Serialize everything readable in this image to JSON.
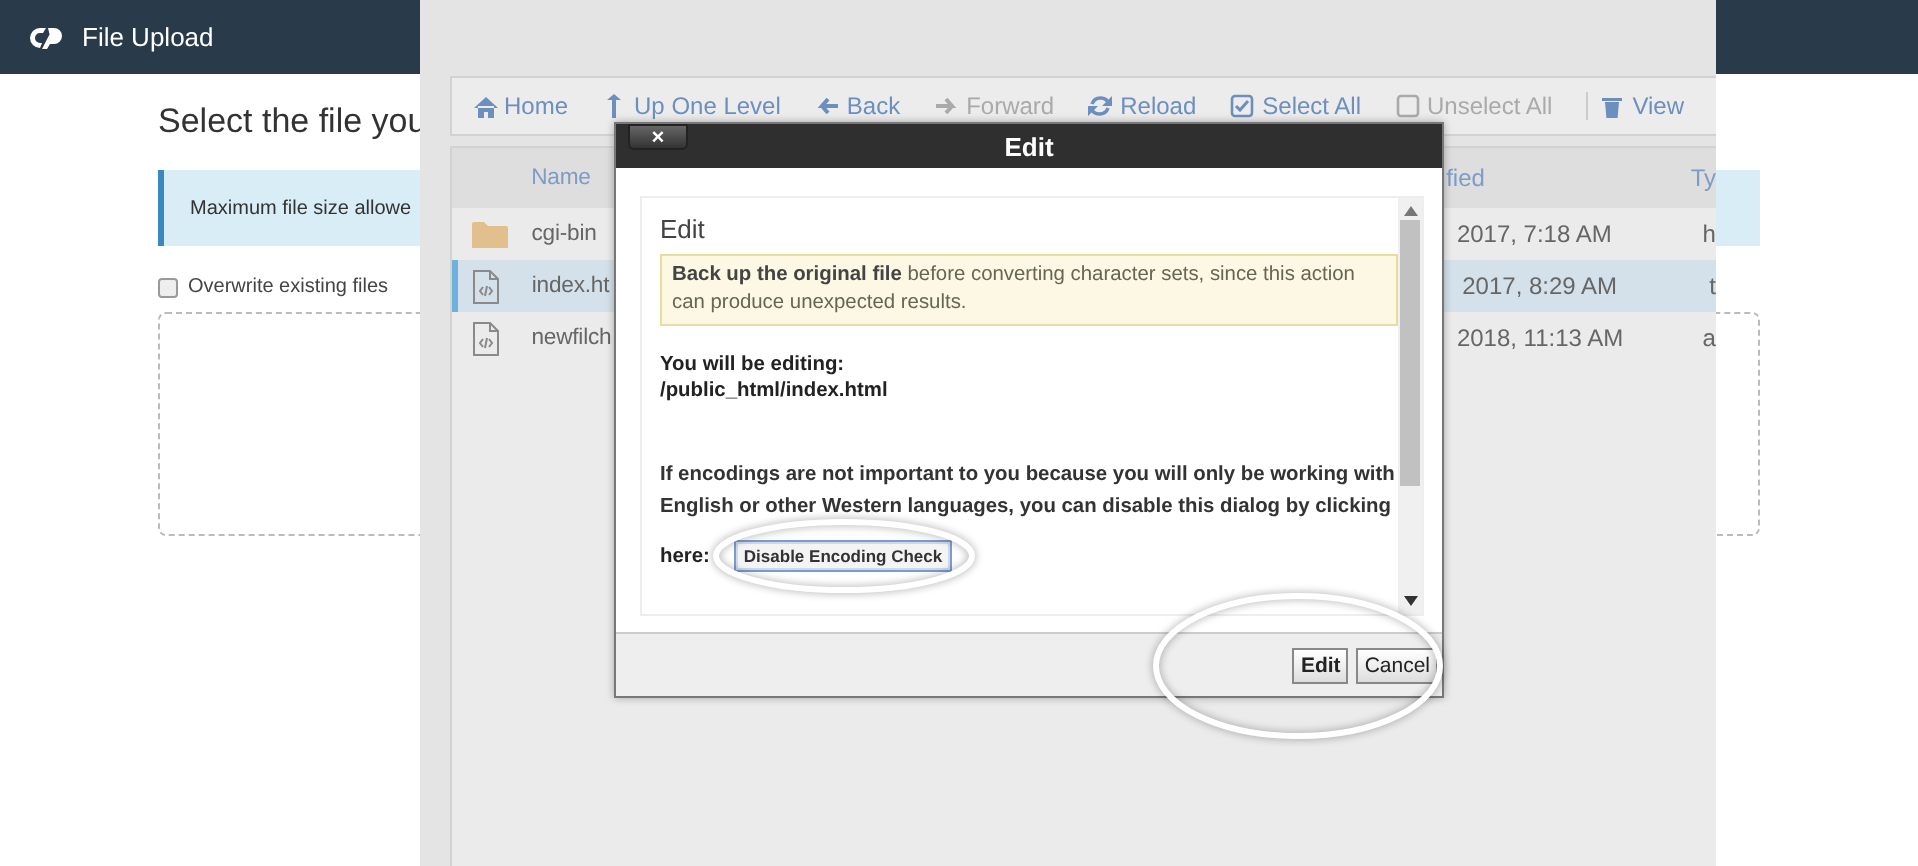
{
  "page": {
    "title": "File Upload",
    "heading": "Select the file you",
    "notice": "Maximum file size allowe",
    "overwrite": {
      "label": "Overwrite existing files",
      "checked": false
    }
  },
  "file_manager": {
    "toolbar": [
      {
        "kind": "home",
        "label": "Home",
        "disabled": false
      },
      {
        "kind": "up",
        "label": "Up One Level",
        "disabled": false
      },
      {
        "kind": "back",
        "label": "Back",
        "disabled": false
      },
      {
        "kind": "forward",
        "label": "Forward",
        "disabled": true
      },
      {
        "kind": "reload",
        "label": "Reload",
        "disabled": false
      },
      {
        "kind": "select",
        "label": "Select All",
        "disabled": false
      },
      {
        "kind": "unselect",
        "label": "Unselect All",
        "disabled": true
      },
      {
        "kind": "view",
        "label": "View",
        "disabled": false
      }
    ],
    "columns": [
      "Name",
      "fied",
      "Ty"
    ],
    "rows": [
      {
        "kind": "folder",
        "name": "cgi-bin",
        "modified": "2017, 7:18 AM",
        "type": "h",
        "selected": false
      },
      {
        "kind": "file",
        "name": "index.ht",
        "modified": "2017, 8:29 AM",
        "type": "t",
        "selected": true
      },
      {
        "kind": "file",
        "name": "newfilch",
        "modified": "2018, 11:13 AM",
        "type": "a",
        "selected": false
      }
    ]
  },
  "dialog": {
    "title": "Edit",
    "close": "×",
    "heading": "Edit",
    "warning": "**Back up the original file** before converting character sets, since this action can produce unexpected results.",
    "editing_label": "You will be editing:",
    "path": "/public_html/index.html",
    "info": "If encodings are not important to you because you will only be working with English or other Western languages, you can disable this dialog by clicking",
    "prompt": "here:",
    "disable_button": "Disable Encoding Check",
    "buttons": [
      "Edit",
      "Cancel"
    ]
  }
}
